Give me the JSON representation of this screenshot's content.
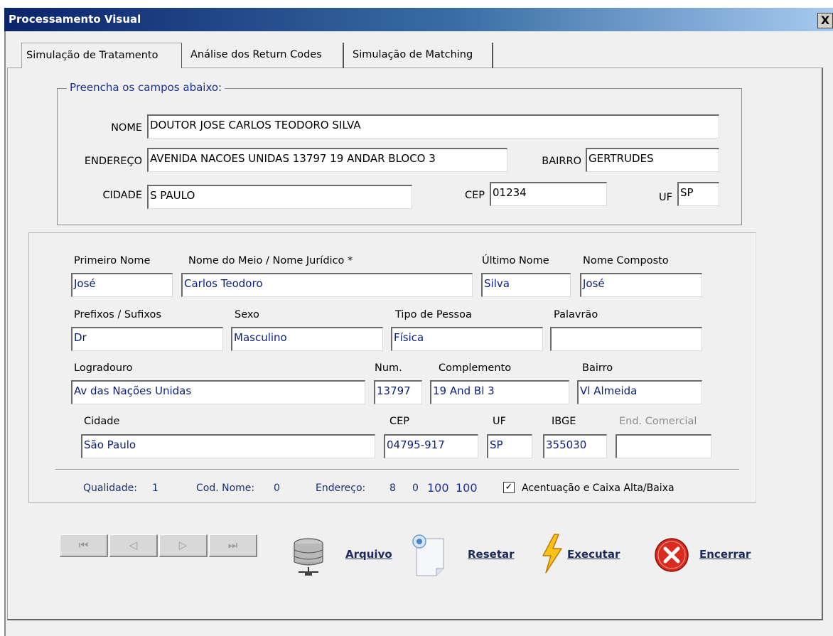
{
  "window": {
    "title": "Processamento Visual",
    "close_glyph": "X"
  },
  "tabs": [
    {
      "label": "Simulação de Tratamento",
      "active": true
    },
    {
      "label": "Análise dos Return Codes",
      "active": false
    },
    {
      "label": "Simulação de Matching",
      "active": false
    }
  ],
  "input_group": {
    "legend": "Preencha os campos abaixo:",
    "nome_label": "NOME",
    "nome_value": "DOUTOR JOSE CARLOS TEODORO SILVA",
    "endereco_label": "ENDEREÇO",
    "endereco_value": "AVENIDA NACOES UNIDAS 13797 19 ANDAR BLOCO 3",
    "bairro_label": "BAIRRO",
    "bairro_value": "GERTRUDES",
    "cidade_label": "CIDADE",
    "cidade_value": "S PAULO",
    "cep_label": "CEP",
    "cep_value": "01234",
    "uf_label": "UF",
    "uf_value": "SP"
  },
  "result": {
    "primeiro_nome_label": "Primeiro Nome",
    "primeiro_nome_value": "José",
    "nome_meio_label": "Nome do Meio / Nome Jurídico *",
    "nome_meio_value": "Carlos Teodoro",
    "ultimo_nome_label": "Último Nome",
    "ultimo_nome_value": "Silva",
    "nome_composto_label": "Nome Composto",
    "nome_composto_value": "José",
    "prefixos_label": "Prefixos / Sufixos",
    "prefixos_value": "Dr",
    "sexo_label": "Sexo",
    "sexo_value": "Masculino",
    "tipo_pessoa_label": "Tipo de Pessoa",
    "tipo_pessoa_value": "Física",
    "palavrao_label": "Palavrão",
    "palavrao_value": "",
    "logradouro_label": "Logradouro",
    "logradouro_value": "Av das Nações Unidas",
    "num_label": "Num.",
    "num_value": "13797",
    "complemento_label": "Complemento",
    "complemento_value": "19 And Bl 3",
    "bairro_label": "Bairro",
    "bairro_value": "Vl Almeida",
    "cidade_label": "Cidade",
    "cidade_value": "São Paulo",
    "cep_label": "CEP",
    "cep_value": "04795-917",
    "uf_label": "UF",
    "uf_value": "SP",
    "ibge_label": "IBGE",
    "ibge_value": "355030",
    "end_comercial_label": "End. Comercial",
    "end_comercial_value": ""
  },
  "status": {
    "qualidade_label": "Qualidade:",
    "qualidade_value": "1",
    "cod_nome_label": "Cod. Nome:",
    "cod_nome_value": "0",
    "endereco_label": "Endereço:",
    "endereco_value_1": "8",
    "endereco_value_2": "0",
    "score_1": "100",
    "score_2": "100",
    "checkbox_label": "Acentuação e Caixa Alta/Baixa",
    "checkbox_checked": true,
    "check_glyph": "✓"
  },
  "navigation": {
    "first_glyph": "⏮",
    "prev_glyph": "◁",
    "next_glyph": "▷",
    "last_glyph": "⏭"
  },
  "actions": {
    "arquivo_label": "Arquivo",
    "resetar_label": "Resetar",
    "executar_label": "Executar",
    "encerrar_label": "Encerrar"
  },
  "colors": {
    "title_gradient_start": "#0a246a",
    "field_text_blue": "#0b1f7a",
    "legend_blue": "#1a2e8c",
    "encerrar_red": "#d92b1e",
    "executar_yellow": "#f7c21a"
  }
}
